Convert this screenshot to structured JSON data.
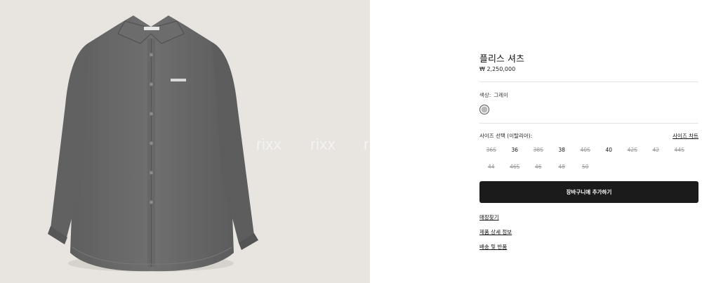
{
  "product": {
    "title": "플리스 셔츠",
    "price": "₩ 2,250,000",
    "image_alt": "gray fleece shirt"
  },
  "watermark": [
    "rixx",
    "rixx",
    "r"
  ],
  "color": {
    "label": "색상:",
    "value": "그레이",
    "swatch_hex": "#b9b9b9"
  },
  "size": {
    "label": "사이즈 선택 (이탈리아):",
    "chart_link": "사이즈 차트",
    "options": [
      {
        "label": "36S",
        "available": false
      },
      {
        "label": "36",
        "available": true
      },
      {
        "label": "38S",
        "available": false
      },
      {
        "label": "38",
        "available": true
      },
      {
        "label": "40S",
        "available": false
      },
      {
        "label": "40",
        "available": true
      },
      {
        "label": "42S",
        "available": false
      },
      {
        "label": "42",
        "available": false
      },
      {
        "label": "44S",
        "available": false
      },
      {
        "label": "44",
        "available": false
      },
      {
        "label": "46S",
        "available": false
      },
      {
        "label": "46",
        "available": false
      },
      {
        "label": "48",
        "available": false
      },
      {
        "label": "50",
        "available": false
      }
    ]
  },
  "actions": {
    "add_to_cart": "장바구니에 추가하기"
  },
  "links": {
    "find_store": "매장찾기",
    "product_details": "제품 상세 정보",
    "shipping_returns": "배송 및 반품"
  }
}
